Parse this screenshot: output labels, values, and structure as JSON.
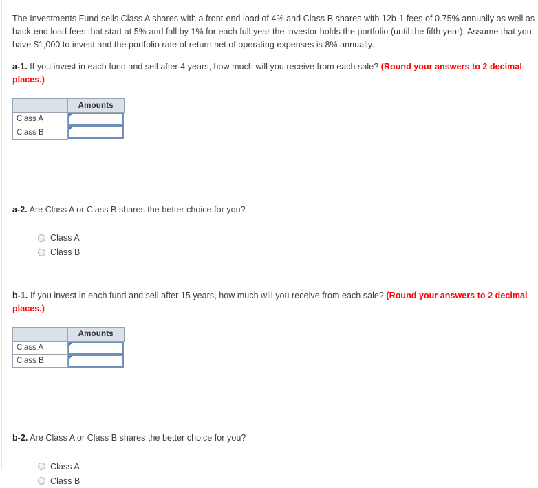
{
  "intro": {
    "text": "The Investments Fund sells Class A shares with a front-end load of 4% and Class B shares with 12b-1 fees of 0.75% annually as well as back-end load fees that start at 5% and fall by 1% for each full year the investor holds the portfolio (until the fifth year). Assume that you have $1,000 to invest and the portfolio rate of return net of operating expenses is 8% annually."
  },
  "questions": {
    "a1": {
      "label": "a-1.",
      "body": " If you invest in each fund and sell after 4 years, how much will you receive from each sale? ",
      "round_note": "(Round your answers to 2 decimal places.)"
    },
    "a2": {
      "label": "a-2.",
      "body": " Are Class A or Class B shares the better choice for you?"
    },
    "b1": {
      "label": "b-1.",
      "body": " If you invest in each fund and sell after 15 years, how much will you receive from each sale? ",
      "round_note": "(Round your answers to 2 decimal places.)"
    },
    "b2": {
      "label": "b-2.",
      "body": " Are Class A or Class B shares the better choice for you?"
    }
  },
  "table_a": {
    "header_blank": "",
    "header_amount": "Amounts",
    "rows": [
      {
        "label": "Class A",
        "value": "",
        "placeholder": ""
      },
      {
        "label": "Class B",
        "value": "",
        "placeholder": ""
      }
    ]
  },
  "table_b": {
    "header_blank": "",
    "header_amount": "Amounts",
    "rows": [
      {
        "label": "Class A",
        "value": "",
        "placeholder": ""
      },
      {
        "label": "Class B",
        "value": "",
        "placeholder": ""
      }
    ]
  },
  "radios_a2": {
    "options": [
      {
        "label": "Class A",
        "selected": false
      },
      {
        "label": "Class B",
        "selected": false
      }
    ]
  },
  "radios_b2": {
    "options": [
      {
        "label": "Class A",
        "selected": false
      },
      {
        "label": "Class B",
        "selected": false
      }
    ]
  },
  "colors": {
    "round_note_red": "#ff0000",
    "table_header_bg": "#dbe1e9",
    "table_border": "#9aa4ae",
    "input_border": "#7190b5",
    "input_marker": "#4a7ebb",
    "body_text": "#3f3f3f"
  }
}
